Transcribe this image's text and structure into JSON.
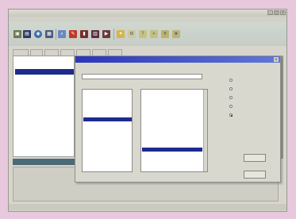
{
  "window": {
    "title": "",
    "controls": [
      "_",
      "□",
      "x"
    ]
  },
  "menu": [
    "",
    "",
    "",
    "",
    "",
    ""
  ],
  "toolbar": {
    "icons": [
      "folder-icon",
      "save-icon",
      "print-icon",
      "globe-icon",
      "search-icon",
      "edit-icon",
      "chart-icon",
      "table-icon",
      "settings-icon",
      "help-icon",
      "tools-icon",
      "run-icon"
    ]
  },
  "tabs": [
    "",
    "",
    "",
    "",
    "",
    "",
    ""
  ],
  "left_list": {
    "rows": [
      "",
      "",
      "",
      "",
      "",
      "",
      "",
      "",
      "",
      "",
      "",
      "",
      "",
      "",
      "",
      "",
      "",
      ""
    ],
    "selected_index": 2
  },
  "status_strip": "",
  "bottom": {
    "labels": [
      "",
      "",
      ""
    ],
    "values": [
      "",
      "",
      ""
    ]
  },
  "dialog": {
    "title": "",
    "field_label": "",
    "left_list_label": "",
    "right_list_label": "",
    "left_items": [
      "",
      "",
      "",
      "",
      "",
      "",
      "",
      "",
      "",
      "",
      "",
      "",
      "",
      "",
      "",
      "",
      "",
      ""
    ],
    "left_selected": 6,
    "right_items": [
      "",
      "",
      "",
      "",
      "",
      "",
      "",
      "",
      "",
      "",
      "",
      "",
      "",
      ""
    ],
    "right_selected": 10,
    "options_label": "",
    "options": [
      "",
      "",
      "",
      "",
      ""
    ],
    "options_selected": 4,
    "ok_label": "",
    "cancel_label": ""
  }
}
